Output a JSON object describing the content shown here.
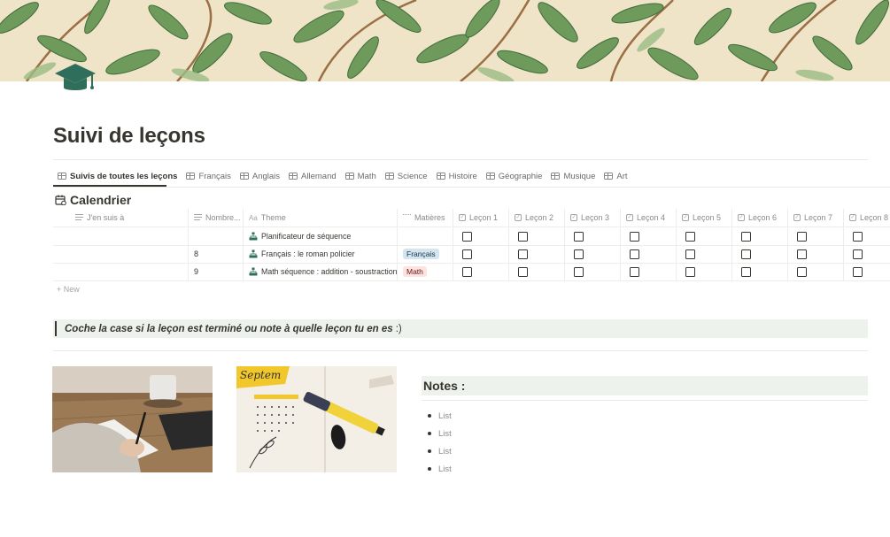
{
  "page": {
    "title": "Suivi de leçons",
    "icon": "graduation-cap-icon"
  },
  "tabs": [
    {
      "label": "Suivis de toutes les leçons",
      "active": true
    },
    {
      "label": "Français"
    },
    {
      "label": "Anglais"
    },
    {
      "label": "Allemand"
    },
    {
      "label": "Math"
    },
    {
      "label": "Science"
    },
    {
      "label": "Histoire"
    },
    {
      "label": "Géographie"
    },
    {
      "label": "Musique"
    },
    {
      "label": "Art"
    }
  ],
  "database": {
    "title": "Calendrier",
    "columns": [
      "J'en suis à",
      "Nombre...",
      "Theme",
      "Matières",
      "Leçon 1",
      "Leçon 2",
      "Leçon 3",
      "Leçon 4",
      "Leçon 5",
      "Leçon 6",
      "Leçon 7",
      "Leçon 8"
    ],
    "rows": [
      {
        "en_cours": "",
        "nombre": "",
        "theme": "Planificateur de séquence",
        "matiere": "",
        "lecons": [
          false,
          false,
          false,
          false,
          false,
          false,
          false,
          false
        ]
      },
      {
        "en_cours": "",
        "nombre": "8",
        "theme": "Français : le roman policier",
        "matiere": "Français",
        "lecons": [
          false,
          false,
          false,
          false,
          false,
          false,
          false,
          false
        ]
      },
      {
        "en_cours": "",
        "nombre": "9",
        "theme": "Math séquence : addition - soustraction",
        "matiere": "Math",
        "lecons": [
          false,
          false,
          false,
          false,
          false,
          false,
          false,
          false
        ]
      }
    ],
    "new_label": "New"
  },
  "callout": {
    "text": "Coche la case si la leçon est terminé ou note à quelle leçon tu en es",
    "suffix": ":)"
  },
  "notes": {
    "title": "Notes :",
    "items": [
      "List",
      "List",
      "List",
      "List"
    ]
  },
  "colors": {
    "accent_green": "#2f6e5a",
    "callout_bg": "#edf3ec",
    "tag_francais": "#d3e5ef",
    "tag_math": "#ffe2dd"
  }
}
